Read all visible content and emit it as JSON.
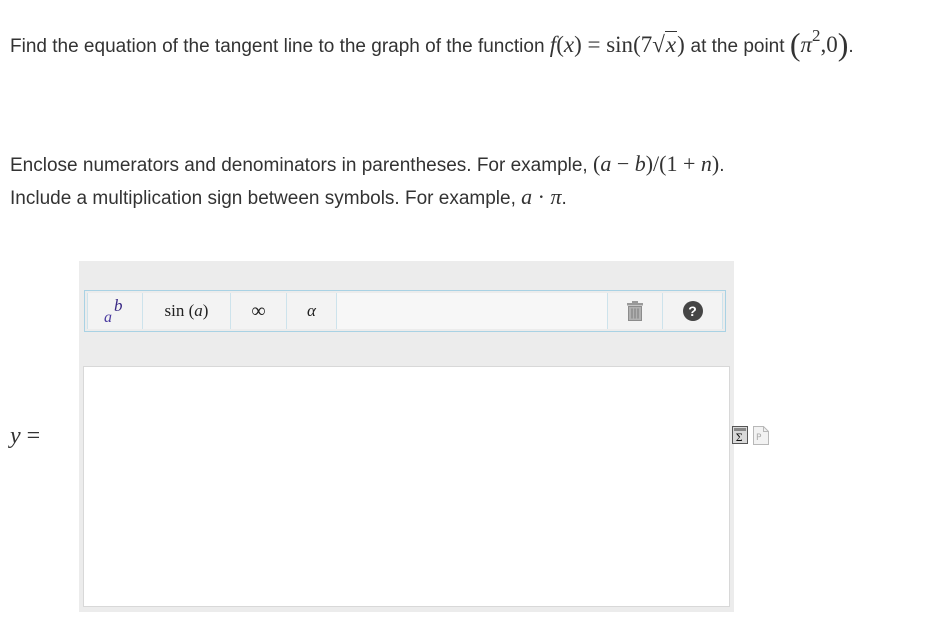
{
  "question": {
    "text_before": "Find the equation of the tangent line to the graph of the function",
    "f": "f",
    "x": "x",
    "sin": "sin",
    "coef": "7",
    "text_mid": "at the point",
    "point_base": "π",
    "point_exp": "2",
    "point_y": "0"
  },
  "instructions": {
    "line1": "Enclose numerators and denominators in parentheses. For example,",
    "line2": "Include a multiplication sign between symbols. For example,",
    "ex1_a": "a",
    "ex1_b": "b",
    "ex1_one": "1",
    "ex1_n": "n",
    "ex2_a": "a",
    "ex2_pi": "π"
  },
  "toolbar": {
    "power_base": "a",
    "power_exp": "b",
    "sin_label": "sin",
    "sin_arg": "a",
    "infinity": "∞",
    "alpha": "α",
    "trash_icon": "trash-icon",
    "help_label": "?"
  },
  "answer": {
    "label": "y",
    "value": ""
  },
  "colors": {
    "toolbar_border": "#a9d2e4",
    "editor_bg": "#ececec",
    "text": "#333333"
  }
}
